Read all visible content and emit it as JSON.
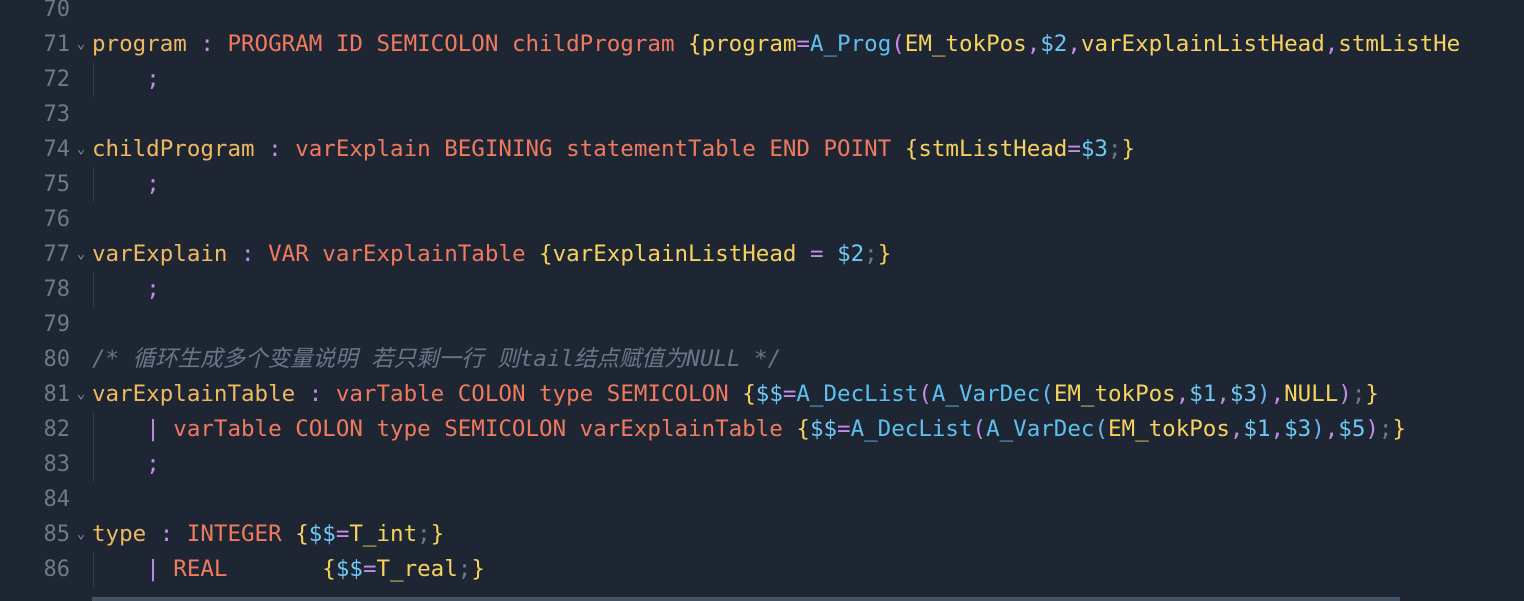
{
  "colors": {
    "background": "#1e2633",
    "line_number": "#6e7a8a",
    "rule_name": "#f0b860",
    "token": "#ef7a5e",
    "punct": "#c58ce8",
    "brace": "#f7d25e",
    "action": "#f7d25e",
    "func": "#5cc0ef",
    "var": "#6ec8f5",
    "comment": "#687688",
    "dim": "#6e7a8a",
    "bracket2": "#6ab4f0"
  },
  "editor": {
    "lines": [
      {
        "num": "70",
        "fold": false,
        "segs": []
      },
      {
        "num": "71",
        "fold": true,
        "segs": [
          {
            "t": "program",
            "c": "rule_name"
          },
          {
            "t": " : ",
            "c": "punct"
          },
          {
            "t": "PROGRAM ID SEMICOLON childProgram ",
            "c": "token"
          },
          {
            "t": "{",
            "c": "brace"
          },
          {
            "t": "program",
            "c": "action"
          },
          {
            "t": "=",
            "c": "punct"
          },
          {
            "t": "A_Prog",
            "c": "func"
          },
          {
            "t": "(",
            "c": "punct"
          },
          {
            "t": "EM_tokPos",
            "c": "action"
          },
          {
            "t": ",",
            "c": "punct"
          },
          {
            "t": "$2",
            "c": "var"
          },
          {
            "t": ",",
            "c": "punct"
          },
          {
            "t": "varExplainListHead",
            "c": "action"
          },
          {
            "t": ",",
            "c": "punct"
          },
          {
            "t": "stmListHe",
            "c": "action"
          }
        ]
      },
      {
        "num": "72",
        "fold": false,
        "segs": [
          {
            "t": "    ",
            "c": "dim"
          },
          {
            "t": ";",
            "c": "punct"
          }
        ]
      },
      {
        "num": "73",
        "fold": false,
        "segs": []
      },
      {
        "num": "74",
        "fold": true,
        "segs": [
          {
            "t": "childProgram",
            "c": "rule_name"
          },
          {
            "t": " : ",
            "c": "punct"
          },
          {
            "t": "varExplain BEGINING statementTable END POINT ",
            "c": "token"
          },
          {
            "t": "{",
            "c": "brace"
          },
          {
            "t": "stmListHead",
            "c": "action"
          },
          {
            "t": "=",
            "c": "punct"
          },
          {
            "t": "$3",
            "c": "var"
          },
          {
            "t": ";",
            "c": "dim"
          },
          {
            "t": "}",
            "c": "brace"
          }
        ]
      },
      {
        "num": "75",
        "fold": false,
        "segs": [
          {
            "t": "    ",
            "c": "dim"
          },
          {
            "t": ";",
            "c": "punct"
          }
        ]
      },
      {
        "num": "76",
        "fold": false,
        "segs": []
      },
      {
        "num": "77",
        "fold": true,
        "segs": [
          {
            "t": "varExplain",
            "c": "rule_name"
          },
          {
            "t": " : ",
            "c": "punct"
          },
          {
            "t": "VAR varExplainTable ",
            "c": "token"
          },
          {
            "t": "{",
            "c": "brace"
          },
          {
            "t": "varExplainListHead ",
            "c": "action"
          },
          {
            "t": "=",
            "c": "punct"
          },
          {
            "t": " ",
            "c": "action"
          },
          {
            "t": "$2",
            "c": "var"
          },
          {
            "t": ";",
            "c": "dim"
          },
          {
            "t": "}",
            "c": "brace"
          }
        ]
      },
      {
        "num": "78",
        "fold": false,
        "segs": [
          {
            "t": "    ",
            "c": "dim"
          },
          {
            "t": ";",
            "c": "punct"
          }
        ]
      },
      {
        "num": "79",
        "fold": false,
        "segs": []
      },
      {
        "num": "80",
        "fold": false,
        "segs": [
          {
            "t": "/* 循环生成多个变量说明 若只剩一行 则tail结点赋值为NULL */",
            "c": "comment",
            "italic": true
          }
        ]
      },
      {
        "num": "81",
        "fold": true,
        "segs": [
          {
            "t": "varExplainTable",
            "c": "rule_name"
          },
          {
            "t": " : ",
            "c": "punct"
          },
          {
            "t": "varTable COLON type SEMICOLON ",
            "c": "token"
          },
          {
            "t": "{",
            "c": "brace"
          },
          {
            "t": "$$",
            "c": "var"
          },
          {
            "t": "=",
            "c": "punct"
          },
          {
            "t": "A_DecList",
            "c": "func"
          },
          {
            "t": "(",
            "c": "punct"
          },
          {
            "t": "A_VarDec",
            "c": "func"
          },
          {
            "t": "(",
            "c": "bracket2"
          },
          {
            "t": "EM_tokPos",
            "c": "action"
          },
          {
            "t": ",",
            "c": "punct"
          },
          {
            "t": "$1",
            "c": "var"
          },
          {
            "t": ",",
            "c": "punct"
          },
          {
            "t": "$3",
            "c": "var"
          },
          {
            "t": ")",
            "c": "bracket2"
          },
          {
            "t": ",",
            "c": "punct"
          },
          {
            "t": "NULL",
            "c": "action"
          },
          {
            "t": ")",
            "c": "punct"
          },
          {
            "t": ";",
            "c": "dim"
          },
          {
            "t": "}",
            "c": "brace"
          }
        ]
      },
      {
        "num": "82",
        "fold": false,
        "segs": [
          {
            "t": "    ",
            "c": "dim"
          },
          {
            "t": "| ",
            "c": "punct"
          },
          {
            "t": "varTable COLON type SEMICOLON varExplainTable ",
            "c": "token"
          },
          {
            "t": "{",
            "c": "brace"
          },
          {
            "t": "$$",
            "c": "var"
          },
          {
            "t": "=",
            "c": "punct"
          },
          {
            "t": "A_DecList",
            "c": "func"
          },
          {
            "t": "(",
            "c": "punct"
          },
          {
            "t": "A_VarDec",
            "c": "func"
          },
          {
            "t": "(",
            "c": "bracket2"
          },
          {
            "t": "EM_tokPos",
            "c": "action"
          },
          {
            "t": ",",
            "c": "punct"
          },
          {
            "t": "$1",
            "c": "var"
          },
          {
            "t": ",",
            "c": "punct"
          },
          {
            "t": "$3",
            "c": "var"
          },
          {
            "t": ")",
            "c": "bracket2"
          },
          {
            "t": ",",
            "c": "punct"
          },
          {
            "t": "$5",
            "c": "var"
          },
          {
            "t": ")",
            "c": "punct"
          },
          {
            "t": ";",
            "c": "dim"
          },
          {
            "t": "}",
            "c": "brace"
          }
        ]
      },
      {
        "num": "83",
        "fold": false,
        "segs": [
          {
            "t": "    ",
            "c": "dim"
          },
          {
            "t": ";",
            "c": "punct"
          }
        ]
      },
      {
        "num": "84",
        "fold": false,
        "segs": []
      },
      {
        "num": "85",
        "fold": true,
        "segs": [
          {
            "t": "type",
            "c": "rule_name"
          },
          {
            "t": " : ",
            "c": "punct"
          },
          {
            "t": "INTEGER ",
            "c": "token"
          },
          {
            "t": "{",
            "c": "brace"
          },
          {
            "t": "$$",
            "c": "var"
          },
          {
            "t": "=",
            "c": "punct"
          },
          {
            "t": "T_int",
            "c": "action"
          },
          {
            "t": ";",
            "c": "dim"
          },
          {
            "t": "}",
            "c": "brace"
          }
        ]
      },
      {
        "num": "86",
        "fold": false,
        "segs": [
          {
            "t": "    ",
            "c": "dim"
          },
          {
            "t": "| ",
            "c": "punct"
          },
          {
            "t": "REAL       ",
            "c": "token"
          },
          {
            "t": "{",
            "c": "brace"
          },
          {
            "t": "$$",
            "c": "var"
          },
          {
            "t": "=",
            "c": "punct"
          },
          {
            "t": "T_real",
            "c": "action"
          },
          {
            "t": ";",
            "c": "dim"
          },
          {
            "t": "}",
            "c": "brace"
          }
        ]
      }
    ]
  },
  "icons": {
    "fold": "chevron-down-icon"
  }
}
